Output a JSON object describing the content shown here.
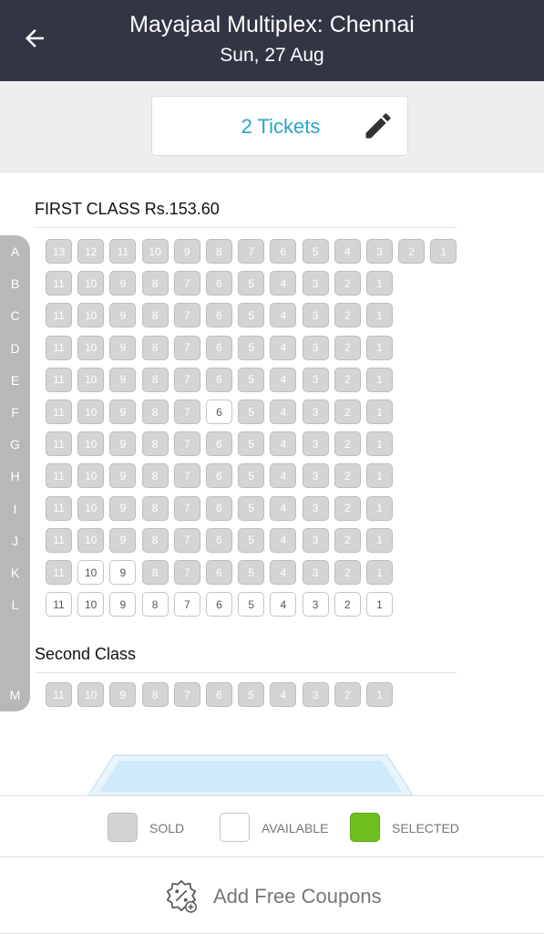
{
  "header": {
    "title": "Mayajaal Multiplex: Chennai",
    "date": "Sun, 27 Aug"
  },
  "ticket_selector": {
    "label": "2 Tickets"
  },
  "sections": [
    {
      "title": "FIRST CLASS Rs.153.60",
      "rows": [
        {
          "letter": "A",
          "seats": [
            {
              "n": "13",
              "s": "sold"
            },
            {
              "n": "12",
              "s": "sold"
            },
            {
              "n": "11",
              "s": "sold"
            },
            {
              "n": "10",
              "s": "sold"
            },
            {
              "n": "9",
              "s": "sold"
            },
            {
              "n": "8",
              "s": "sold"
            },
            {
              "n": "7",
              "s": "sold"
            },
            {
              "n": "6",
              "s": "sold"
            },
            {
              "n": "5",
              "s": "sold"
            },
            {
              "n": "4",
              "s": "sold"
            },
            {
              "n": "3",
              "s": "sold"
            },
            {
              "n": "2",
              "s": "sold"
            },
            {
              "n": "1",
              "s": "sold"
            }
          ]
        },
        {
          "letter": "B",
          "seats": [
            {
              "n": "11",
              "s": "sold"
            },
            {
              "n": "10",
              "s": "sold"
            },
            {
              "n": "9",
              "s": "sold"
            },
            {
              "n": "8",
              "s": "sold"
            },
            {
              "n": "7",
              "s": "sold"
            },
            {
              "n": "6",
              "s": "sold"
            },
            {
              "n": "5",
              "s": "sold"
            },
            {
              "n": "4",
              "s": "sold"
            },
            {
              "n": "3",
              "s": "sold"
            },
            {
              "n": "2",
              "s": "sold"
            },
            {
              "n": "1",
              "s": "sold"
            }
          ]
        },
        {
          "letter": "C",
          "seats": [
            {
              "n": "11",
              "s": "sold"
            },
            {
              "n": "10",
              "s": "sold"
            },
            {
              "n": "9",
              "s": "sold"
            },
            {
              "n": "8",
              "s": "sold"
            },
            {
              "n": "7",
              "s": "sold"
            },
            {
              "n": "6",
              "s": "sold"
            },
            {
              "n": "5",
              "s": "sold"
            },
            {
              "n": "4",
              "s": "sold"
            },
            {
              "n": "3",
              "s": "sold"
            },
            {
              "n": "2",
              "s": "sold"
            },
            {
              "n": "1",
              "s": "sold"
            }
          ]
        },
        {
          "letter": "D",
          "seats": [
            {
              "n": "11",
              "s": "sold"
            },
            {
              "n": "10",
              "s": "sold"
            },
            {
              "n": "9",
              "s": "sold"
            },
            {
              "n": "8",
              "s": "sold"
            },
            {
              "n": "7",
              "s": "sold"
            },
            {
              "n": "6",
              "s": "sold"
            },
            {
              "n": "5",
              "s": "sold"
            },
            {
              "n": "4",
              "s": "sold"
            },
            {
              "n": "3",
              "s": "sold"
            },
            {
              "n": "2",
              "s": "sold"
            },
            {
              "n": "1",
              "s": "sold"
            }
          ]
        },
        {
          "letter": "E",
          "seats": [
            {
              "n": "11",
              "s": "sold"
            },
            {
              "n": "10",
              "s": "sold"
            },
            {
              "n": "9",
              "s": "sold"
            },
            {
              "n": "8",
              "s": "sold"
            },
            {
              "n": "7",
              "s": "sold"
            },
            {
              "n": "6",
              "s": "sold"
            },
            {
              "n": "5",
              "s": "sold"
            },
            {
              "n": "4",
              "s": "sold"
            },
            {
              "n": "3",
              "s": "sold"
            },
            {
              "n": "2",
              "s": "sold"
            },
            {
              "n": "1",
              "s": "sold"
            }
          ]
        },
        {
          "letter": "F",
          "seats": [
            {
              "n": "11",
              "s": "sold"
            },
            {
              "n": "10",
              "s": "sold"
            },
            {
              "n": "9",
              "s": "sold"
            },
            {
              "n": "8",
              "s": "sold"
            },
            {
              "n": "7",
              "s": "sold"
            },
            {
              "n": "6",
              "s": "available"
            },
            {
              "n": "5",
              "s": "sold"
            },
            {
              "n": "4",
              "s": "sold"
            },
            {
              "n": "3",
              "s": "sold"
            },
            {
              "n": "2",
              "s": "sold"
            },
            {
              "n": "1",
              "s": "sold"
            }
          ]
        },
        {
          "letter": "G",
          "seats": [
            {
              "n": "11",
              "s": "sold"
            },
            {
              "n": "10",
              "s": "sold"
            },
            {
              "n": "9",
              "s": "sold"
            },
            {
              "n": "8",
              "s": "sold"
            },
            {
              "n": "7",
              "s": "sold"
            },
            {
              "n": "6",
              "s": "sold"
            },
            {
              "n": "5",
              "s": "sold"
            },
            {
              "n": "4",
              "s": "sold"
            },
            {
              "n": "3",
              "s": "sold"
            },
            {
              "n": "2",
              "s": "sold"
            },
            {
              "n": "1",
              "s": "sold"
            }
          ]
        },
        {
          "letter": "H",
          "seats": [
            {
              "n": "11",
              "s": "sold"
            },
            {
              "n": "10",
              "s": "sold"
            },
            {
              "n": "9",
              "s": "sold"
            },
            {
              "n": "8",
              "s": "sold"
            },
            {
              "n": "7",
              "s": "sold"
            },
            {
              "n": "6",
              "s": "sold"
            },
            {
              "n": "5",
              "s": "sold"
            },
            {
              "n": "4",
              "s": "sold"
            },
            {
              "n": "3",
              "s": "sold"
            },
            {
              "n": "2",
              "s": "sold"
            },
            {
              "n": "1",
              "s": "sold"
            }
          ]
        },
        {
          "letter": "I",
          "seats": [
            {
              "n": "11",
              "s": "sold"
            },
            {
              "n": "10",
              "s": "sold"
            },
            {
              "n": "9",
              "s": "sold"
            },
            {
              "n": "8",
              "s": "sold"
            },
            {
              "n": "7",
              "s": "sold"
            },
            {
              "n": "6",
              "s": "sold"
            },
            {
              "n": "5",
              "s": "sold"
            },
            {
              "n": "4",
              "s": "sold"
            },
            {
              "n": "3",
              "s": "sold"
            },
            {
              "n": "2",
              "s": "sold"
            },
            {
              "n": "1",
              "s": "sold"
            }
          ]
        },
        {
          "letter": "J",
          "seats": [
            {
              "n": "11",
              "s": "sold"
            },
            {
              "n": "10",
              "s": "sold"
            },
            {
              "n": "9",
              "s": "sold"
            },
            {
              "n": "8",
              "s": "sold"
            },
            {
              "n": "7",
              "s": "sold"
            },
            {
              "n": "6",
              "s": "sold"
            },
            {
              "n": "5",
              "s": "sold"
            },
            {
              "n": "4",
              "s": "sold"
            },
            {
              "n": "3",
              "s": "sold"
            },
            {
              "n": "2",
              "s": "sold"
            },
            {
              "n": "1",
              "s": "sold"
            }
          ]
        },
        {
          "letter": "K",
          "seats": [
            {
              "n": "11",
              "s": "sold"
            },
            {
              "n": "10",
              "s": "available"
            },
            {
              "n": "9",
              "s": "available"
            },
            {
              "n": "8",
              "s": "sold"
            },
            {
              "n": "7",
              "s": "sold"
            },
            {
              "n": "6",
              "s": "sold"
            },
            {
              "n": "5",
              "s": "sold"
            },
            {
              "n": "4",
              "s": "sold"
            },
            {
              "n": "3",
              "s": "sold"
            },
            {
              "n": "2",
              "s": "sold"
            },
            {
              "n": "1",
              "s": "sold"
            }
          ]
        },
        {
          "letter": "L",
          "seats": [
            {
              "n": "11",
              "s": "available"
            },
            {
              "n": "10",
              "s": "available"
            },
            {
              "n": "9",
              "s": "available"
            },
            {
              "n": "8",
              "s": "available"
            },
            {
              "n": "7",
              "s": "available"
            },
            {
              "n": "6",
              "s": "available"
            },
            {
              "n": "5",
              "s": "available"
            },
            {
              "n": "4",
              "s": "available"
            },
            {
              "n": "3",
              "s": "available"
            },
            {
              "n": "2",
              "s": "available"
            },
            {
              "n": "1",
              "s": "available"
            }
          ]
        }
      ]
    },
    {
      "title": "Second Class",
      "rows": [
        {
          "letter": "M",
          "seats": [
            {
              "n": "11",
              "s": "sold"
            },
            {
              "n": "10",
              "s": "sold"
            },
            {
              "n": "9",
              "s": "sold"
            },
            {
              "n": "8",
              "s": "sold"
            },
            {
              "n": "7",
              "s": "sold"
            },
            {
              "n": "6",
              "s": "sold"
            },
            {
              "n": "5",
              "s": "sold"
            },
            {
              "n": "4",
              "s": "sold"
            },
            {
              "n": "3",
              "s": "sold"
            },
            {
              "n": "2",
              "s": "sold"
            },
            {
              "n": "1",
              "s": "sold"
            }
          ]
        }
      ]
    }
  ],
  "legend": {
    "sold": {
      "label": "SOLD",
      "color": "#d4d4d4"
    },
    "available": {
      "label": "AVAILABLE",
      "color": "#ffffff"
    },
    "selected": {
      "label": "SELECTED",
      "color": "#6fbf1f"
    }
  },
  "coupon": {
    "label": "Add Free Coupons"
  },
  "colors": {
    "header_bg": "#333545",
    "accent": "#2aa3c9"
  },
  "icons": {
    "back": "arrow-left-icon",
    "edit": "pencil-icon",
    "coupon": "coupon-icon"
  }
}
